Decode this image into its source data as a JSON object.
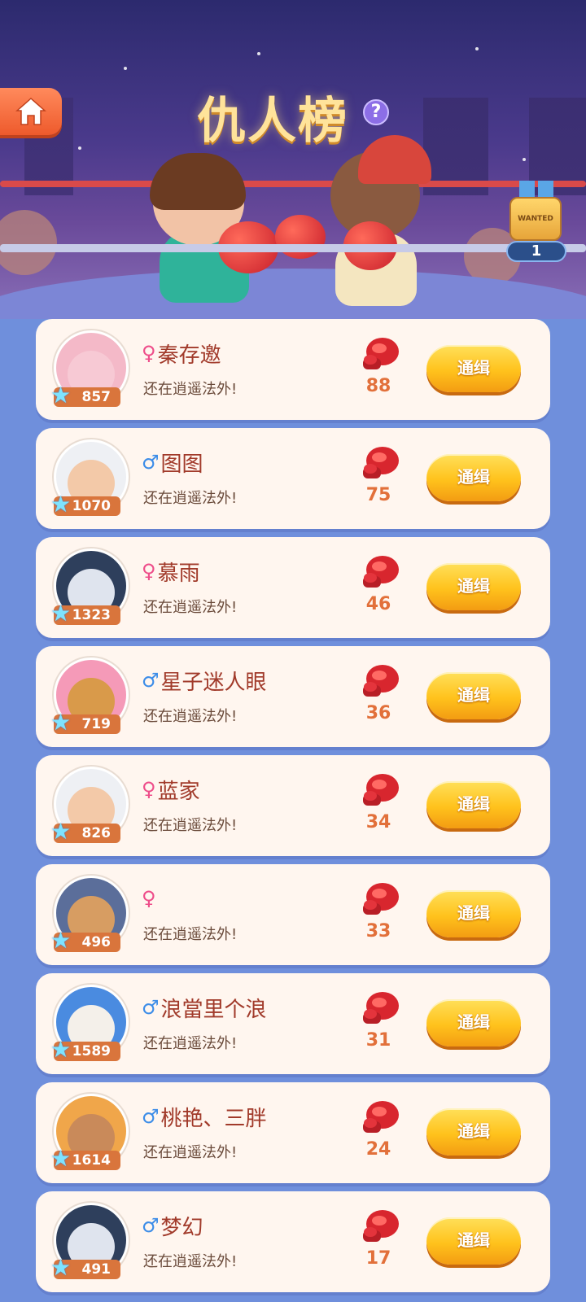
{
  "header": {
    "title": "仇人榜",
    "help_icon": "?",
    "home_icon": "home-icon",
    "wanted_badge": {
      "label": "WANTED",
      "count": "1"
    }
  },
  "colors": {
    "background": "#6f8fdc",
    "card": "#fff6ef",
    "name": "#a13a2a",
    "female": "#ee4d8a",
    "male": "#3d8de8",
    "hits": "#e2703a",
    "button": "#ffc21c",
    "level_tag": "#d9753c"
  },
  "entries": [
    {
      "gender": "♀",
      "gender_type": "f",
      "name": "秦存邀",
      "status": "还在逍遥法外!",
      "level": "857",
      "hits": "88",
      "button": "通缉",
      "avatar": "pink-bird"
    },
    {
      "gender": "♂",
      "gender_type": "m",
      "name": "图图",
      "status": "还在逍遥法外!",
      "level": "1070",
      "hits": "75",
      "button": "通缉",
      "avatar": "white-hair-kid"
    },
    {
      "gender": "♀",
      "gender_type": "f",
      "name": "慕雨",
      "status": "还在逍遥法外!",
      "level": "1323",
      "hits": "46",
      "button": "通缉",
      "avatar": "husky-dog"
    },
    {
      "gender": "♂",
      "gender_type": "m",
      "name": "星子迷人眼",
      "status": "还在逍遥法外!",
      "level": "719",
      "hits": "36",
      "button": "通缉",
      "avatar": "pink-hat-kid"
    },
    {
      "gender": "♀",
      "gender_type": "f",
      "name": "蓝家",
      "status": "还在逍遥法外!",
      "level": "826",
      "hits": "34",
      "button": "通缉",
      "avatar": "white-hair-kid"
    },
    {
      "gender": "♀",
      "gender_type": "f",
      "name": "",
      "status": "还在逍遥法外!",
      "level": "496",
      "hits": "33",
      "button": "通缉",
      "avatar": "pirate"
    },
    {
      "gender": "♂",
      "gender_type": "m",
      "name": "浪當里个浪",
      "status": "还在逍遥法外!",
      "level": "1589",
      "hits": "31",
      "button": "通缉",
      "avatar": "beagle-dog"
    },
    {
      "gender": "♂",
      "gender_type": "m",
      "name": "桃艳、三胖",
      "status": "还在逍遥法外!",
      "level": "1614",
      "hits": "24",
      "button": "通缉",
      "avatar": "orange-cap-kid"
    },
    {
      "gender": "♂",
      "gender_type": "m",
      "name": "梦幻",
      "status": "还在逍遥法外!",
      "level": "491",
      "hits": "17",
      "button": "通缉",
      "avatar": "husky-dog"
    }
  ]
}
